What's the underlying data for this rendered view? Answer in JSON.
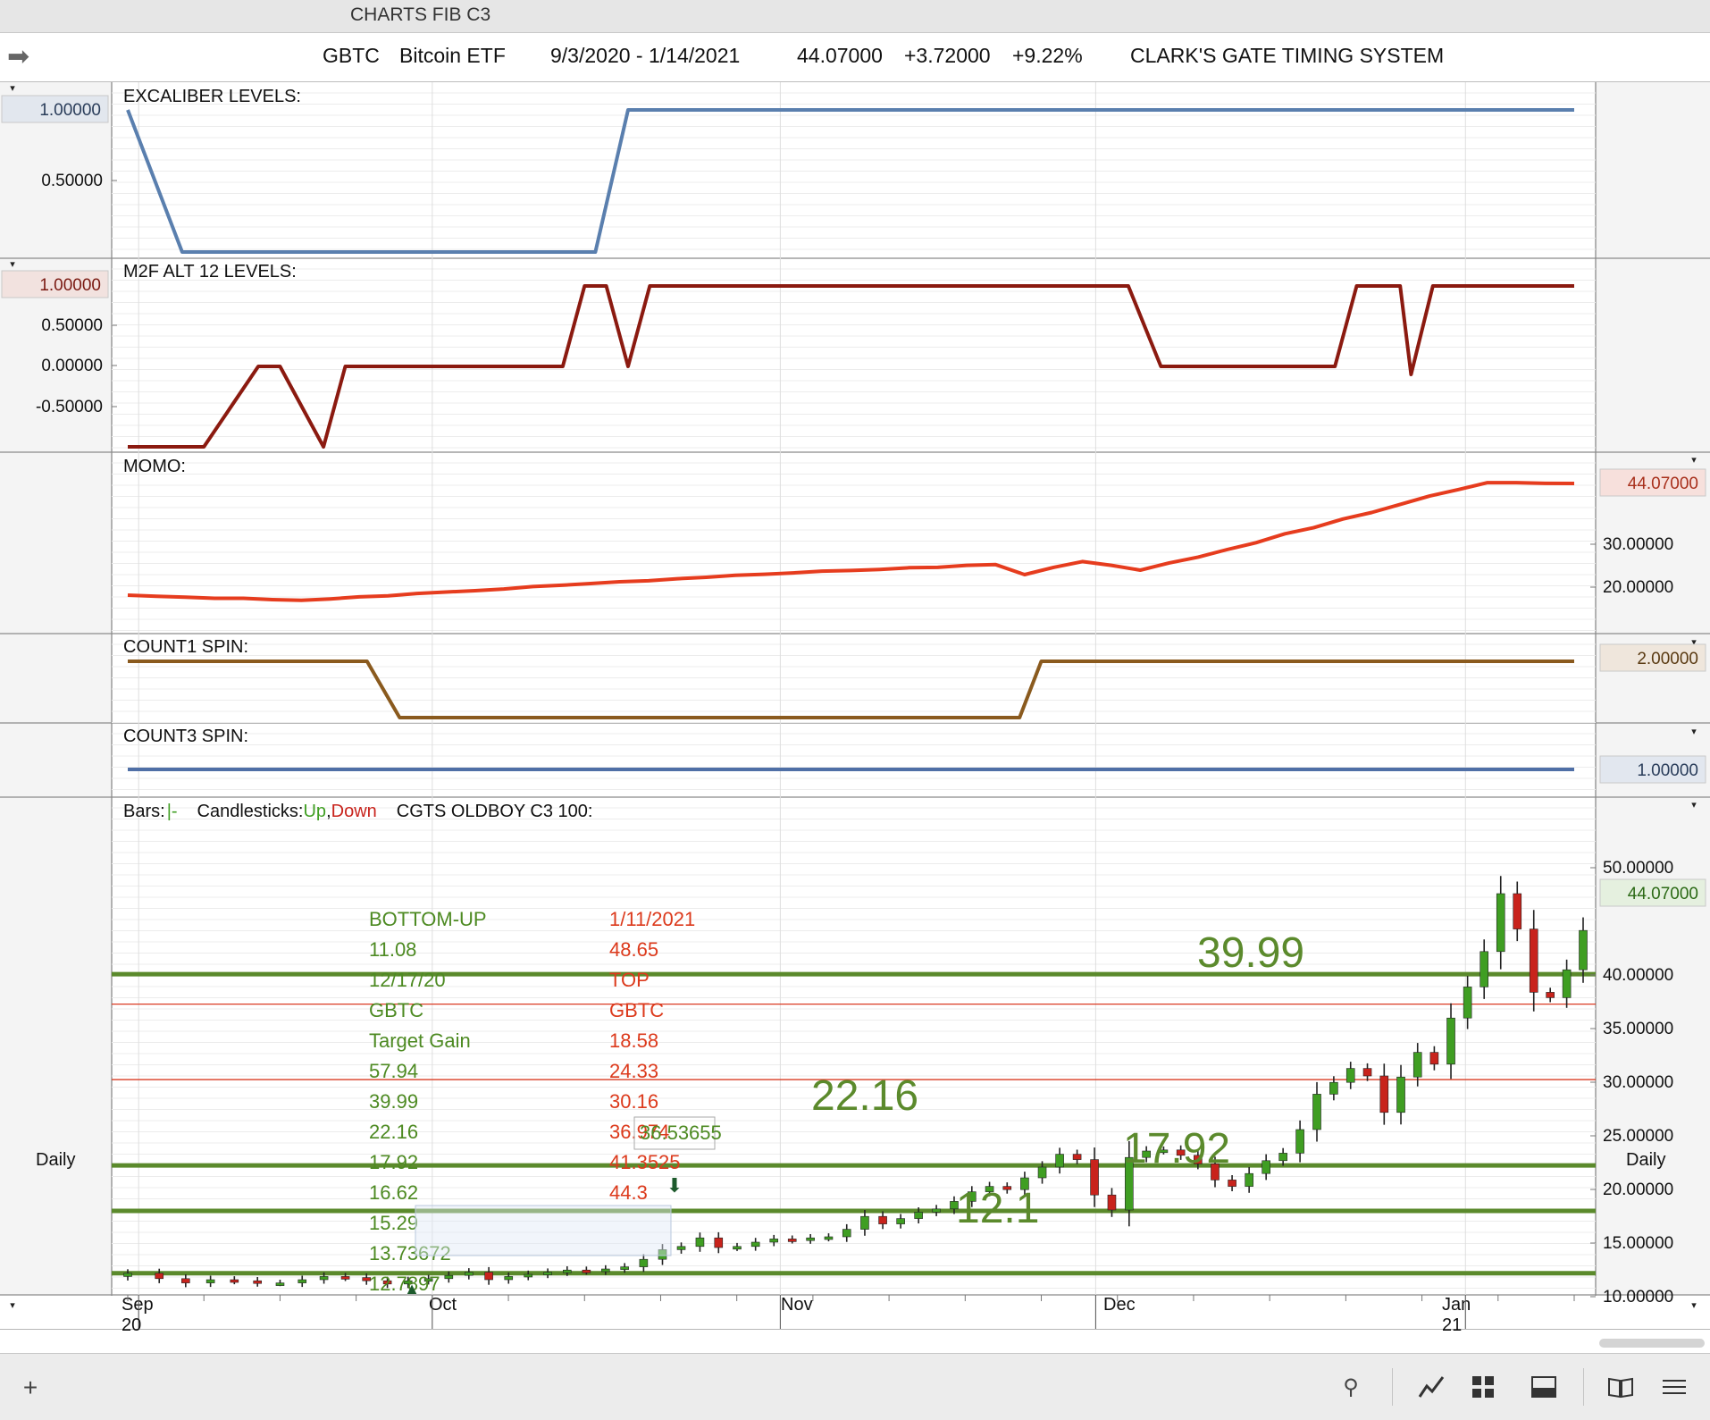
{
  "window": {
    "title": "CHARTS FIB C3"
  },
  "header": {
    "symbol": "GBTC",
    "name": "Bitcoin ETF",
    "date_range": "9/3/2020 - 1/14/2021",
    "last": "44.07000",
    "change": "+3.72000",
    "change_pct": "+9.22%",
    "system": "CLARK'S GATE TIMING SYSTEM"
  },
  "panels": {
    "excaliber": {
      "label": "EXCALIBER LEVELS:",
      "color": "#5a7fae",
      "ticks": [
        "1.00000",
        "0.50000"
      ]
    },
    "m2f": {
      "label": "M2F ALT 12 LEVELS:",
      "color": "#8b1a10",
      "ticks": [
        "1.00000",
        "0.50000",
        "0.00000",
        "-0.50000"
      ]
    },
    "momo": {
      "label": "MOMO:",
      "color": "#e63c1e",
      "ticks": [
        "30.00000",
        "20.00000"
      ],
      "last": "44.07000"
    },
    "count1": {
      "label": "COUNT1 SPIN:",
      "color": "#8a5a1e",
      "last": "2.00000"
    },
    "count3": {
      "label": "COUNT3 SPIN:",
      "color": "#4f6fa6",
      "last": "1.00000"
    },
    "price": {
      "legend_bars": "Bars:",
      "legend_bars_symbol": "|-",
      "legend_candles": "Candlesticks:",
      "legend_up": "Up",
      "legend_down": "Down",
      "legend_series": "CGTS OLDBOY  C3 100:",
      "up_color": "#3f9e22",
      "down_color": "#c8231c",
      "ticks": [
        "50.00000",
        "40.00000",
        "35.00000",
        "30.00000",
        "25.00000",
        "20.00000",
        "15.00000",
        "10.00000"
      ],
      "last": "44.07000"
    }
  },
  "annotations": {
    "left_col": [
      "BOTTOM-UP",
      "11.08",
      "12/17/20",
      "GBTC",
      "Target Gain",
      "57.94",
      "39.99",
      "22.16",
      "17.92",
      "16.62",
      "15.29",
      "13.73672",
      "12.7897"
    ],
    "right_col": [
      "1/11/2021",
      "48.65",
      "TOP",
      "GBTC",
      "18.58",
      "24.33",
      "30.16",
      "36.974",
      "41.3525",
      "44.3"
    ],
    "box_value": "36.53655",
    "big_labels": {
      "l3999": "39.99",
      "l2216": "22.16",
      "l1792": "17.92",
      "l121": "12.1"
    }
  },
  "xaxis": {
    "months": [
      "Sep",
      "Oct",
      "Nov",
      "Dec",
      "Jan"
    ],
    "years": [
      "20",
      "21"
    ],
    "period_left": "Daily",
    "period_right": "Daily"
  },
  "chart_data": [
    {
      "type": "line",
      "title": "EXCALIBER LEVELS",
      "x_range": [
        "9/3/2020",
        "1/14/2021"
      ],
      "series": [
        {
          "name": "EXCALIBER LEVELS",
          "x": [
            "9/3/2020",
            "9/8/2020",
            "10/16/2020",
            "10/19/2020",
            "1/14/2021"
          ],
          "values": [
            1,
            0,
            0,
            1,
            1
          ]
        }
      ]
    },
    {
      "type": "line",
      "title": "M2F ALT 12 LEVELS",
      "ylim": [
        -1,
        1
      ],
      "series": [
        {
          "name": "M2F ALT 12 LEVELS",
          "x": [
            "9/3/2020",
            "9/10/2020",
            "9/15/2020",
            "9/17/2020",
            "9/21/2020",
            "9/23/2020",
            "10/13/2020",
            "10/15/2020",
            "10/17/2020",
            "10/19/2020",
            "10/21/2020",
            "12/4/2020",
            "12/7/2020",
            "12/23/2020",
            "12/25/2020",
            "12/29/2020",
            "12/30/2020",
            "1/1/2021",
            "1/14/2021"
          ],
          "values": [
            -1,
            -1,
            0,
            0,
            -1,
            0,
            0,
            1,
            1,
            0,
            1,
            1,
            0,
            0,
            1,
            1,
            -0.1,
            1,
            1
          ]
        }
      ]
    },
    {
      "type": "line",
      "title": "MOMO",
      "ylim": [
        8,
        46
      ],
      "series": [
        {
          "name": "MOMO",
          "values": [
            11.5,
            11.2,
            10.9,
            10.6,
            10.6,
            10.2,
            10.0,
            10.4,
            11.0,
            11.3,
            12.0,
            12.4,
            12.8,
            13.3,
            14.0,
            14.4,
            14.9,
            15.4,
            15.7,
            16.3,
            16.7,
            17.3,
            17.6,
            18.0,
            18.5,
            18.7,
            19.0,
            19.5,
            19.6,
            20.2,
            20.4,
            17.5,
            19.6,
            21.3,
            20.2,
            18.8,
            20.9,
            22.6,
            24.8,
            26.8,
            29.4,
            31.2,
            33.7,
            35.6,
            38.0,
            40.4,
            42.3,
            44.3,
            44.3,
            44.1,
            44.07
          ]
        }
      ]
    },
    {
      "type": "line",
      "title": "COUNT1 SPIN",
      "series": [
        {
          "name": "COUNT1 SPIN",
          "x": [
            "9/3/2020",
            "9/25/2020",
            "9/28/2020",
            "11/24/2020",
            "11/26/2020",
            "1/14/2021"
          ],
          "values": [
            2,
            2,
            1,
            1,
            2,
            2
          ]
        }
      ]
    },
    {
      "type": "line",
      "title": "COUNT3 SPIN",
      "series": [
        {
          "name": "COUNT3 SPIN",
          "x": [
            "9/3/2020",
            "1/14/2021"
          ],
          "values": [
            1,
            1
          ]
        }
      ]
    },
    {
      "type": "scatter",
      "title": "GBTC Bitcoin ETF Daily Candlesticks",
      "ylim": [
        8,
        52
      ],
      "horizontal_levels": [
        39.99,
        22.16,
        17.92,
        12.1,
        37.2,
        30.16
      ],
      "series": [
        {
          "name": "Candlesticks",
          "close": [
            12.1,
            11.6,
            11.2,
            11.5,
            11.4,
            11.2,
            11.2,
            11.5,
            11.8,
            11.7,
            11.4,
            11.1,
            11.4,
            11.6,
            11.9,
            12.2,
            11.5,
            11.8,
            12.0,
            12.2,
            12.4,
            12.3,
            12.5,
            12.7,
            13.4,
            14.3,
            14.6,
            15.4,
            14.5,
            14.6,
            15.0,
            15.3,
            15.2,
            15.4,
            15.5,
            16.2,
            17.4,
            16.7,
            17.2,
            17.8,
            18.1,
            18.8,
            19.7,
            20.2,
            19.9,
            21.0,
            22.0,
            23.2,
            22.7,
            19.4,
            18.0,
            22.9,
            23.5,
            23.6,
            23.1,
            22.3,
            20.8,
            20.2,
            21.4,
            22.6,
            23.3,
            25.5,
            28.8,
            29.9,
            31.2,
            30.5,
            27.1,
            30.4,
            32.7,
            31.6,
            35.9,
            38.8,
            42.1,
            47.5,
            44.2,
            38.3,
            37.8,
            40.4,
            44.07
          ]
        }
      ]
    }
  ]
}
